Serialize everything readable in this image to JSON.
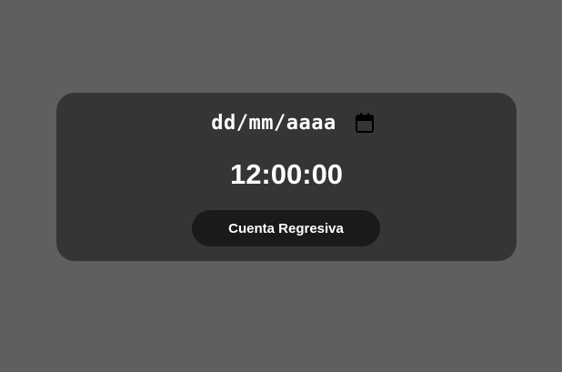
{
  "date_input": {
    "placeholder": "dd/mm/aaaa",
    "icon": "calendar-icon"
  },
  "time_display": "12:00:00",
  "countdown_button_label": "Cuenta Regresiva",
  "colors": {
    "page_background": "#5f5f5f",
    "card_background": "#353535",
    "button_background": "#1a1a1a",
    "text": "#ffffff"
  }
}
